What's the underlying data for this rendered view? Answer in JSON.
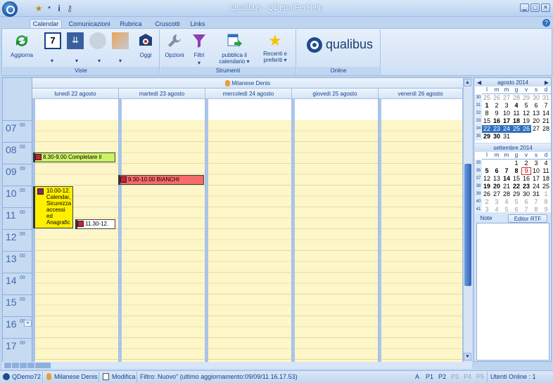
{
  "window": {
    "title": "Qualibus  -  QDemoPerHelp"
  },
  "tabs": [
    "Calendar",
    "Comunicazioni",
    "Rubrica",
    "Cruscotti",
    "Links"
  ],
  "ribbon": {
    "viste": {
      "label": "Viste",
      "aggiorna": "Aggiorna",
      "oggi": "Oggi",
      "day_icon_number": "7"
    },
    "strumenti": {
      "label": "Strumenti",
      "opzioni": "Opzioni",
      "filtri": "Filtri",
      "pubblica_1": "pubblica il",
      "pubblica_2": "calendario",
      "recenti_1": "Recenti e",
      "recenti_2": "preferiti"
    },
    "online": {
      "label": "Online",
      "logo": "qualibus"
    }
  },
  "calendar": {
    "resource": "Milanese Denis",
    "days": [
      "lunedì 22 agosto",
      "martedì 23 agosto",
      "mercoledì 24 agosto",
      "giovedì 25 agosto",
      "venerdì 26 agosto"
    ],
    "hours": [
      "07",
      "08",
      "09",
      "10",
      "11",
      "12",
      "13",
      "14",
      "15",
      "16",
      "17"
    ],
    "minutes": "00",
    "events": [
      {
        "text": "8.30-9.00 Completare il",
        "color": "#ccf266"
      },
      {
        "text": "9.30-10.00 BIANCHI",
        "color": "#f76a6a"
      },
      {
        "text": "10.00-12. Calendar, Sicurezza accessi ed Anagrafic",
        "color": "#fff000"
      },
      {
        "text": "11.30-12.",
        "color": "#ffffff"
      }
    ]
  },
  "mini_calendars": [
    {
      "title": "agosto 2014",
      "weekdays": [
        "l",
        "m",
        "m",
        "g",
        "v",
        "s",
        "d"
      ],
      "weeks": [
        {
          "n": "30",
          "days": [
            [
              "25",
              "g"
            ],
            [
              "26",
              "g"
            ],
            [
              "27",
              "g"
            ],
            [
              "28",
              "g"
            ],
            [
              "29",
              "g"
            ],
            [
              "30",
              "g"
            ],
            [
              "31",
              "g"
            ]
          ]
        },
        {
          "n": "31",
          "days": [
            [
              "1",
              "b"
            ],
            [
              "2",
              ""
            ],
            [
              "3",
              ""
            ],
            [
              "4",
              "b"
            ],
            [
              "5",
              ""
            ],
            [
              "6",
              ""
            ],
            [
              "7",
              ""
            ]
          ]
        },
        {
          "n": "32",
          "days": [
            [
              "8",
              ""
            ],
            [
              "9",
              ""
            ],
            [
              "10",
              ""
            ],
            [
              "11",
              ""
            ],
            [
              "12",
              ""
            ],
            [
              "13",
              ""
            ],
            [
              "14",
              ""
            ]
          ]
        },
        {
          "n": "33",
          "days": [
            [
              "15",
              ""
            ],
            [
              "16",
              "b"
            ],
            [
              "17",
              "b"
            ],
            [
              "18",
              "b"
            ],
            [
              "19",
              ""
            ],
            [
              "20",
              ""
            ],
            [
              "21",
              ""
            ]
          ]
        },
        {
          "n": "34",
          "days": [
            [
              "22",
              "sel"
            ],
            [
              "23",
              "sel"
            ],
            [
              "24",
              "sel"
            ],
            [
              "25",
              "sel"
            ],
            [
              "26",
              "sel"
            ],
            [
              "27",
              ""
            ],
            [
              "28",
              ""
            ]
          ]
        },
        {
          "n": "35",
          "days": [
            [
              "29",
              "b"
            ],
            [
              "30",
              "b"
            ],
            [
              "31",
              ""
            ],
            [
              "",
              ""
            ],
            [
              "",
              ""
            ],
            [
              "",
              ""
            ],
            [
              "",
              ""
            ]
          ]
        }
      ]
    },
    {
      "title": "settembre 2014",
      "weekdays": [
        "l",
        "m",
        "m",
        "g",
        "v",
        "s",
        "d"
      ],
      "weeks": [
        {
          "n": "35",
          "days": [
            [
              "",
              ""
            ],
            [
              "",
              ""
            ],
            [
              "",
              ""
            ],
            [
              "",
              ""
            ],
            [
              "1",
              ""
            ],
            [
              "2",
              ""
            ],
            [
              "3",
              ""
            ],
            [
              "4",
              ""
            ]
          ]
        },
        {
          "n": "36",
          "days": [
            [
              "5",
              "b"
            ],
            [
              "6",
              "b"
            ],
            [
              "7",
              "b"
            ],
            [
              "8",
              "b"
            ],
            [
              "9",
              "today"
            ],
            [
              "10",
              ""
            ],
            [
              "11",
              ""
            ]
          ]
        },
        {
          "n": "37",
          "days": [
            [
              "12",
              ""
            ],
            [
              "13",
              ""
            ],
            [
              "14",
              "b"
            ],
            [
              "15",
              ""
            ],
            [
              "16",
              ""
            ],
            [
              "17",
              ""
            ],
            [
              "18",
              ""
            ]
          ]
        },
        {
          "n": "38",
          "days": [
            [
              "19",
              "b"
            ],
            [
              "20",
              "b"
            ],
            [
              "21",
              ""
            ],
            [
              "22",
              "b"
            ],
            [
              "23",
              "b"
            ],
            [
              "24",
              ""
            ],
            [
              "25",
              ""
            ]
          ]
        },
        {
          "n": "39",
          "days": [
            [
              "26",
              ""
            ],
            [
              "27",
              ""
            ],
            [
              "28",
              ""
            ],
            [
              "29",
              ""
            ],
            [
              "30",
              ""
            ],
            [
              "31",
              ""
            ],
            [
              "1",
              "g"
            ]
          ]
        },
        {
          "n": "40",
          "days": [
            [
              "2",
              "g"
            ],
            [
              "3",
              "g"
            ],
            [
              "4",
              "g"
            ],
            [
              "5",
              "g"
            ],
            [
              "6",
              "g"
            ],
            [
              "7",
              "g"
            ],
            [
              "8",
              "g"
            ]
          ]
        },
        {
          "n": "41",
          "days": [
            [
              "3",
              "g"
            ],
            [
              "4",
              "g"
            ],
            [
              "5",
              "g"
            ],
            [
              "6",
              "g"
            ],
            [
              "7",
              "g"
            ],
            [
              "8",
              "g"
            ],
            [
              "9",
              "g"
            ]
          ]
        }
      ]
    }
  ],
  "notes": {
    "tab1": "Note",
    "tab2": "Editor RTF"
  },
  "status": {
    "db": "QDemo72",
    "user": "Milanese Denis",
    "mode": "Modifica",
    "filter": "Filtro: Nuovo\" (ultimo aggiornamento:09/09/11 16.17.53)",
    "a": "A",
    "p1": "P1",
    "p2": "P2",
    "p3": "P3",
    "p4": "P4",
    "p5": "P5",
    "online": "Utenti Online : 1"
  }
}
